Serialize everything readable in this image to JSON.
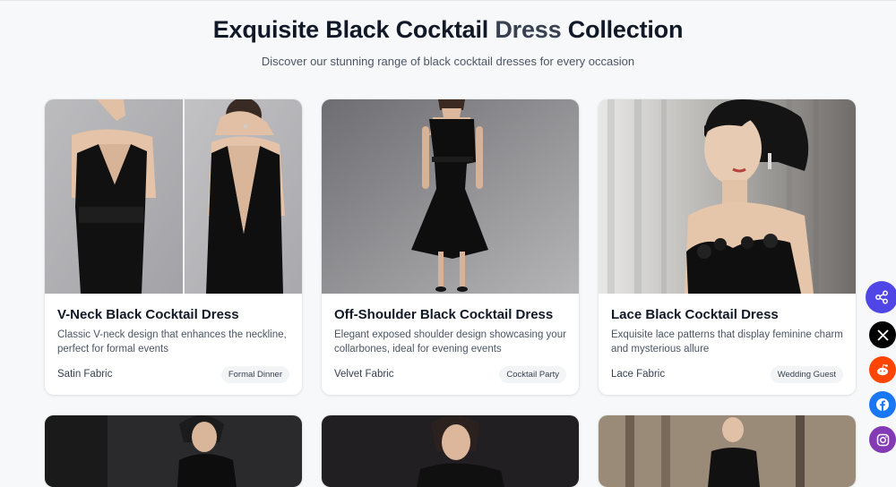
{
  "header": {
    "title_part1": "Exquisite Black Cocktail ",
    "title_accent": "Dress",
    "title_part2": " Collection",
    "subtitle": "Discover our stunning range of black cocktail dresses for every occasion"
  },
  "cards": [
    {
      "name": "V-Neck Black Cocktail Dress",
      "description": "Classic V-neck design that enhances the neckline, perfect for formal events",
      "fabric": "Satin Fabric",
      "occasion": "Formal Dinner"
    },
    {
      "name": "Off-Shoulder Black Cocktail Dress",
      "description": "Elegant exposed shoulder design showcasing your collarbones, ideal for evening events",
      "fabric": "Velvet Fabric",
      "occasion": "Cocktail Party"
    },
    {
      "name": "Lace Black Cocktail Dress",
      "description": "Exquisite lace patterns that display feminine charm and mysterious allure",
      "fabric": "Lace Fabric",
      "occasion": "Wedding Guest"
    }
  ],
  "social": [
    {
      "icon": "share-icon",
      "color": "#4f46e5"
    },
    {
      "icon": "x-icon",
      "color": "#000000"
    },
    {
      "icon": "reddit-icon",
      "color": "#ff4500"
    },
    {
      "icon": "facebook-icon",
      "color": "#1877f2"
    },
    {
      "icon": "instagram-icon",
      "color": "#833ab4"
    }
  ]
}
